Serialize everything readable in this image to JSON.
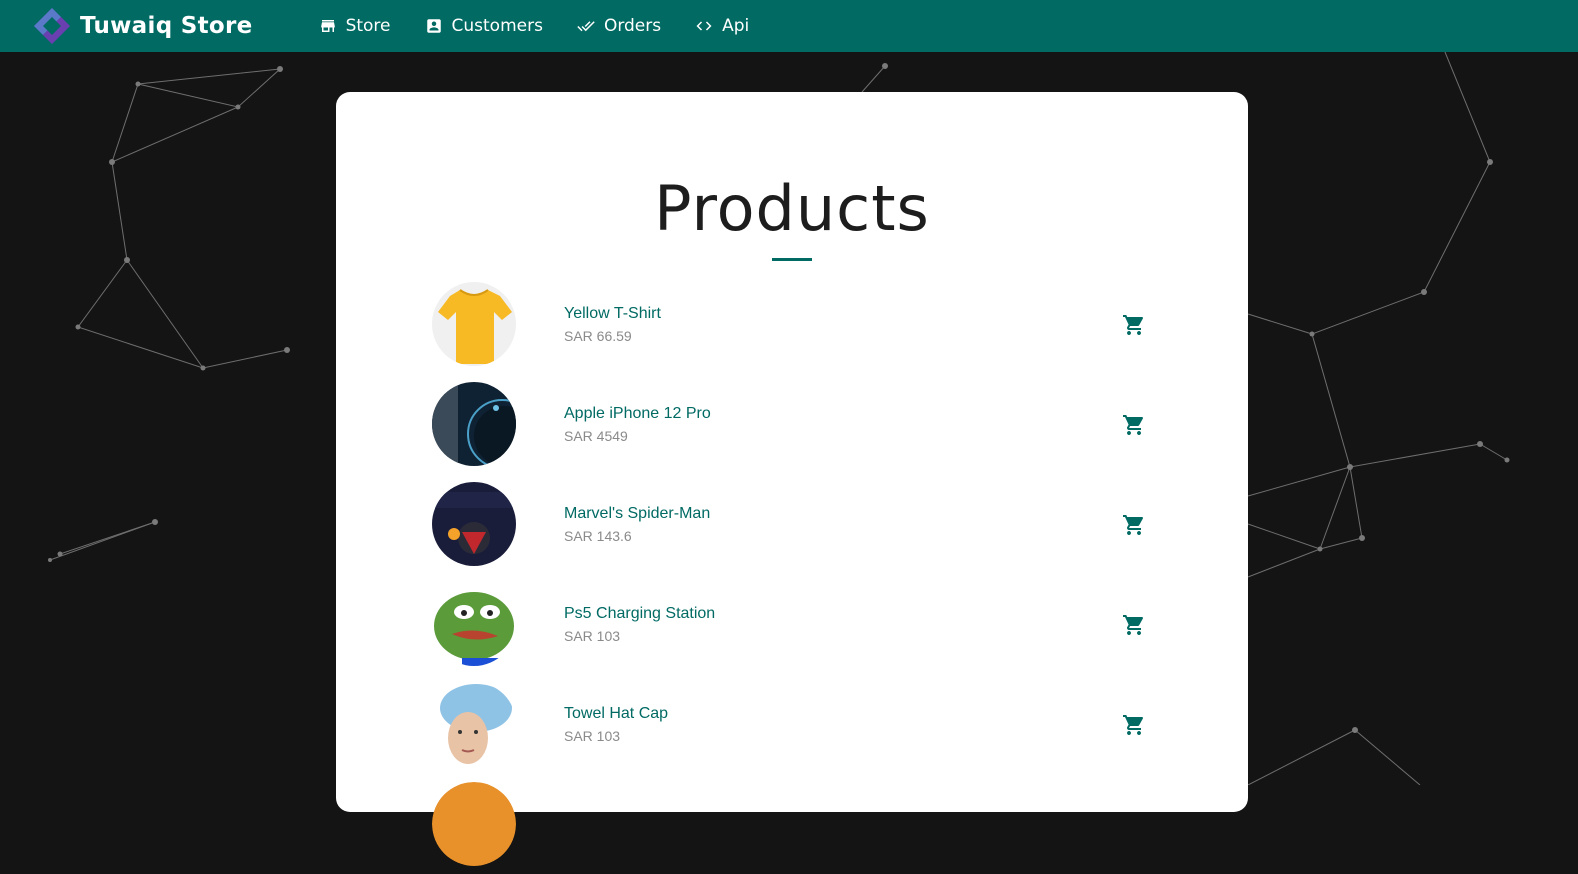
{
  "brand": {
    "name": "Tuwaiq Store"
  },
  "nav": {
    "items": [
      {
        "label": "Store",
        "icon": "store-icon"
      },
      {
        "label": "Customers",
        "icon": "account-box-icon"
      },
      {
        "label": "Orders",
        "icon": "check-icon"
      },
      {
        "label": "Api",
        "icon": "code-icon"
      }
    ]
  },
  "main": {
    "title": "Products",
    "products": [
      {
        "name": "Yellow T-Shirt",
        "price": "SAR 66.59",
        "image": "yellow-tshirt-image"
      },
      {
        "name": "Apple iPhone 12 Pro",
        "price": "SAR 4549",
        "image": "iphone-image"
      },
      {
        "name": "Marvel's Spider-Man",
        "price": "SAR 143.6",
        "image": "spiderman-cover-image"
      },
      {
        "name": "Ps5 Charging Station",
        "price": "SAR 103",
        "image": "frog-image"
      },
      {
        "name": "Towel Hat Cap",
        "price": "SAR 103",
        "image": "towel-cap-image"
      }
    ]
  },
  "colors": {
    "accent": "#006a63",
    "background": "#141414",
    "card": "#ffffff"
  }
}
